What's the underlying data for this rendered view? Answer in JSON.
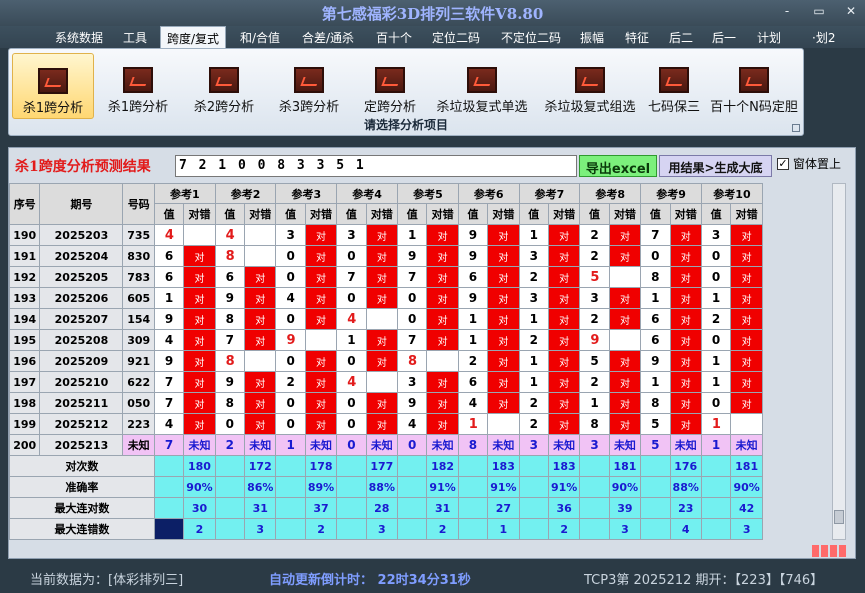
{
  "app_title": "第七感福彩3D排列三软件V8.80",
  "window_buttons": [
    "-",
    "▭",
    "✕"
  ],
  "menu": [
    {
      "label": "系统数据",
      "active": false
    },
    {
      "label": "工具",
      "active": false
    },
    {
      "label": "跨度/复式",
      "active": true
    },
    {
      "label": "和/合值",
      "active": false
    },
    {
      "label": "合差/通杀",
      "active": false
    },
    {
      "label": "百十个",
      "active": false
    },
    {
      "label": "定位二码",
      "active": false
    },
    {
      "label": "不定位二码",
      "active": false
    },
    {
      "label": "振幅",
      "active": false
    },
    {
      "label": "特征",
      "active": false
    },
    {
      "label": "后二",
      "active": false
    },
    {
      "label": "后一",
      "active": false
    },
    {
      "label": "计划",
      "active": false
    },
    {
      "label": "·划2",
      "active": false
    }
  ],
  "ribbon": {
    "buttons": [
      {
        "label": "杀1跨分析",
        "active": true
      },
      {
        "label": "杀1跨分析",
        "active": false
      },
      {
        "label": "杀2跨分析",
        "active": false
      },
      {
        "label": "杀3跨分析",
        "active": false
      },
      {
        "label": "定跨分析",
        "active": false
      },
      {
        "label": "杀垃圾复式单选",
        "active": false
      },
      {
        "label": "杀垃圾复式组选",
        "active": false
      },
      {
        "label": "七码保三",
        "active": false
      },
      {
        "label": "百十个N码定胆",
        "active": false
      }
    ],
    "caption": "请选择分析项目"
  },
  "result": {
    "label": "杀1跨度分析预测结果",
    "value": "7 2 1 0 0 8 3 3 5 1",
    "export_button": "导出excel",
    "generate_button": "用结果>生成大底",
    "pin_checkbox": {
      "label": "窗体置上",
      "checked": true
    }
  },
  "table": {
    "fixed_headers": [
      "序号",
      "期号",
      "号码"
    ],
    "ref_headers": [
      "参考1",
      "参考2",
      "参考3",
      "参考4",
      "参考5",
      "参考6",
      "参考7",
      "参考8",
      "参考9",
      "参考10"
    ],
    "sub_headers": [
      "值",
      "对错"
    ],
    "ok_text": "对",
    "rows": [
      {
        "seq": "190",
        "issue": "2025203",
        "code": "735",
        "refs": [
          [
            "4",
            0,
            1
          ],
          [
            "4",
            0,
            1
          ],
          [
            "3",
            1,
            0
          ],
          [
            "3",
            1,
            0
          ],
          [
            "1",
            1,
            0
          ],
          [
            "9",
            1,
            0
          ],
          [
            "1",
            1,
            0
          ],
          [
            "2",
            1,
            0
          ],
          [
            "7",
            1,
            0
          ],
          [
            "3",
            1,
            0
          ]
        ]
      },
      {
        "seq": "191",
        "issue": "2025204",
        "code": "830",
        "refs": [
          [
            "6",
            1,
            0
          ],
          [
            "8",
            0,
            1
          ],
          [
            "0",
            1,
            0
          ],
          [
            "0",
            1,
            0
          ],
          [
            "9",
            1,
            0
          ],
          [
            "9",
            1,
            0
          ],
          [
            "3",
            1,
            0
          ],
          [
            "2",
            1,
            0
          ],
          [
            "0",
            1,
            0
          ],
          [
            "0",
            1,
            0
          ]
        ]
      },
      {
        "seq": "192",
        "issue": "2025205",
        "code": "783",
        "refs": [
          [
            "6",
            1,
            0
          ],
          [
            "6",
            1,
            0
          ],
          [
            "0",
            1,
            0
          ],
          [
            "7",
            1,
            0
          ],
          [
            "7",
            1,
            0
          ],
          [
            "6",
            1,
            0
          ],
          [
            "2",
            1,
            0
          ],
          [
            "5",
            0,
            1
          ],
          [
            "8",
            1,
            0
          ],
          [
            "0",
            1,
            0
          ]
        ]
      },
      {
        "seq": "193",
        "issue": "2025206",
        "code": "605",
        "refs": [
          [
            "1",
            1,
            0
          ],
          [
            "9",
            1,
            0
          ],
          [
            "4",
            1,
            0
          ],
          [
            "0",
            1,
            0
          ],
          [
            "0",
            1,
            0
          ],
          [
            "9",
            1,
            0
          ],
          [
            "3",
            1,
            0
          ],
          [
            "3",
            1,
            0
          ],
          [
            "1",
            1,
            0
          ],
          [
            "1",
            1,
            0
          ]
        ]
      },
      {
        "seq": "194",
        "issue": "2025207",
        "code": "154",
        "refs": [
          [
            "9",
            1,
            0
          ],
          [
            "8",
            1,
            0
          ],
          [
            "0",
            1,
            0
          ],
          [
            "4",
            0,
            1
          ],
          [
            "0",
            1,
            0
          ],
          [
            "1",
            1,
            0
          ],
          [
            "1",
            1,
            0
          ],
          [
            "2",
            1,
            0
          ],
          [
            "6",
            1,
            0
          ],
          [
            "2",
            1,
            0
          ]
        ]
      },
      {
        "seq": "195",
        "issue": "2025208",
        "code": "309",
        "refs": [
          [
            "4",
            1,
            0
          ],
          [
            "7",
            1,
            0
          ],
          [
            "9",
            0,
            1
          ],
          [
            "1",
            1,
            0
          ],
          [
            "7",
            1,
            0
          ],
          [
            "1",
            1,
            0
          ],
          [
            "2",
            1,
            0
          ],
          [
            "9",
            0,
            1
          ],
          [
            "6",
            1,
            0
          ],
          [
            "0",
            1,
            0
          ]
        ]
      },
      {
        "seq": "196",
        "issue": "2025209",
        "code": "921",
        "refs": [
          [
            "9",
            1,
            0
          ],
          [
            "8",
            0,
            1
          ],
          [
            "0",
            1,
            0
          ],
          [
            "0",
            1,
            0
          ],
          [
            "8",
            0,
            1
          ],
          [
            "2",
            1,
            0
          ],
          [
            "1",
            1,
            0
          ],
          [
            "5",
            1,
            0
          ],
          [
            "9",
            1,
            0
          ],
          [
            "1",
            1,
            0
          ]
        ]
      },
      {
        "seq": "197",
        "issue": "2025210",
        "code": "622",
        "refs": [
          [
            "7",
            1,
            0
          ],
          [
            "9",
            1,
            0
          ],
          [
            "2",
            1,
            0
          ],
          [
            "4",
            0,
            1
          ],
          [
            "3",
            1,
            0
          ],
          [
            "6",
            1,
            0
          ],
          [
            "1",
            1,
            0
          ],
          [
            "2",
            1,
            0
          ],
          [
            "1",
            1,
            0
          ],
          [
            "1",
            1,
            0
          ]
        ]
      },
      {
        "seq": "198",
        "issue": "2025211",
        "code": "050",
        "refs": [
          [
            "7",
            1,
            0
          ],
          [
            "8",
            1,
            0
          ],
          [
            "0",
            1,
            0
          ],
          [
            "0",
            1,
            0
          ],
          [
            "9",
            1,
            0
          ],
          [
            "4",
            1,
            0
          ],
          [
            "2",
            1,
            0
          ],
          [
            "1",
            1,
            0
          ],
          [
            "8",
            1,
            0
          ],
          [
            "0",
            1,
            0
          ]
        ]
      },
      {
        "seq": "199",
        "issue": "2025212",
        "code": "223",
        "refs": [
          [
            "4",
            1,
            0
          ],
          [
            "0",
            1,
            0
          ],
          [
            "0",
            1,
            0
          ],
          [
            "0",
            1,
            0
          ],
          [
            "4",
            1,
            0
          ],
          [
            "1",
            0,
            1
          ],
          [
            "2",
            1,
            0
          ],
          [
            "8",
            1,
            0
          ],
          [
            "5",
            1,
            0
          ],
          [
            "1",
            0,
            1
          ]
        ]
      }
    ],
    "unknown_row": {
      "seq": "200",
      "issue": "2025213",
      "code": "未知",
      "values": [
        "7",
        "2",
        "1",
        "0",
        "0",
        "8",
        "3",
        "3",
        "5",
        "1"
      ],
      "unknown_text": "未知"
    },
    "stats": [
      {
        "label": "对次数",
        "values": [
          "180",
          "172",
          "178",
          "177",
          "182",
          "183",
          "183",
          "181",
          "176",
          "181"
        ]
      },
      {
        "label": "准确率",
        "values": [
          "90%",
          "86%",
          "89%",
          "88%",
          "91%",
          "91%",
          "91%",
          "90%",
          "88%",
          "90%"
        ]
      },
      {
        "label": "最大连对数",
        "values": [
          "30",
          "31",
          "37",
          "28",
          "31",
          "27",
          "36",
          "39",
          "23",
          "42"
        ]
      },
      {
        "label": "最大连错数",
        "values": [
          "2",
          "3",
          "2",
          "3",
          "2",
          "1",
          "2",
          "3",
          "4",
          "3"
        ]
      }
    ]
  },
  "footer": {
    "current_data": "当前数据为：[体彩排列三]",
    "countdown": "自动更新倒计时： 22时34分31秒",
    "latest": "TCP3第 2025212 期开：【223】【746】"
  },
  "colors": {
    "ok_red": "#f00000",
    "unknown_pink": "#f1c3f5",
    "stat_cyan": "#73f0f0",
    "accent_blue": "#1a1ad0"
  }
}
